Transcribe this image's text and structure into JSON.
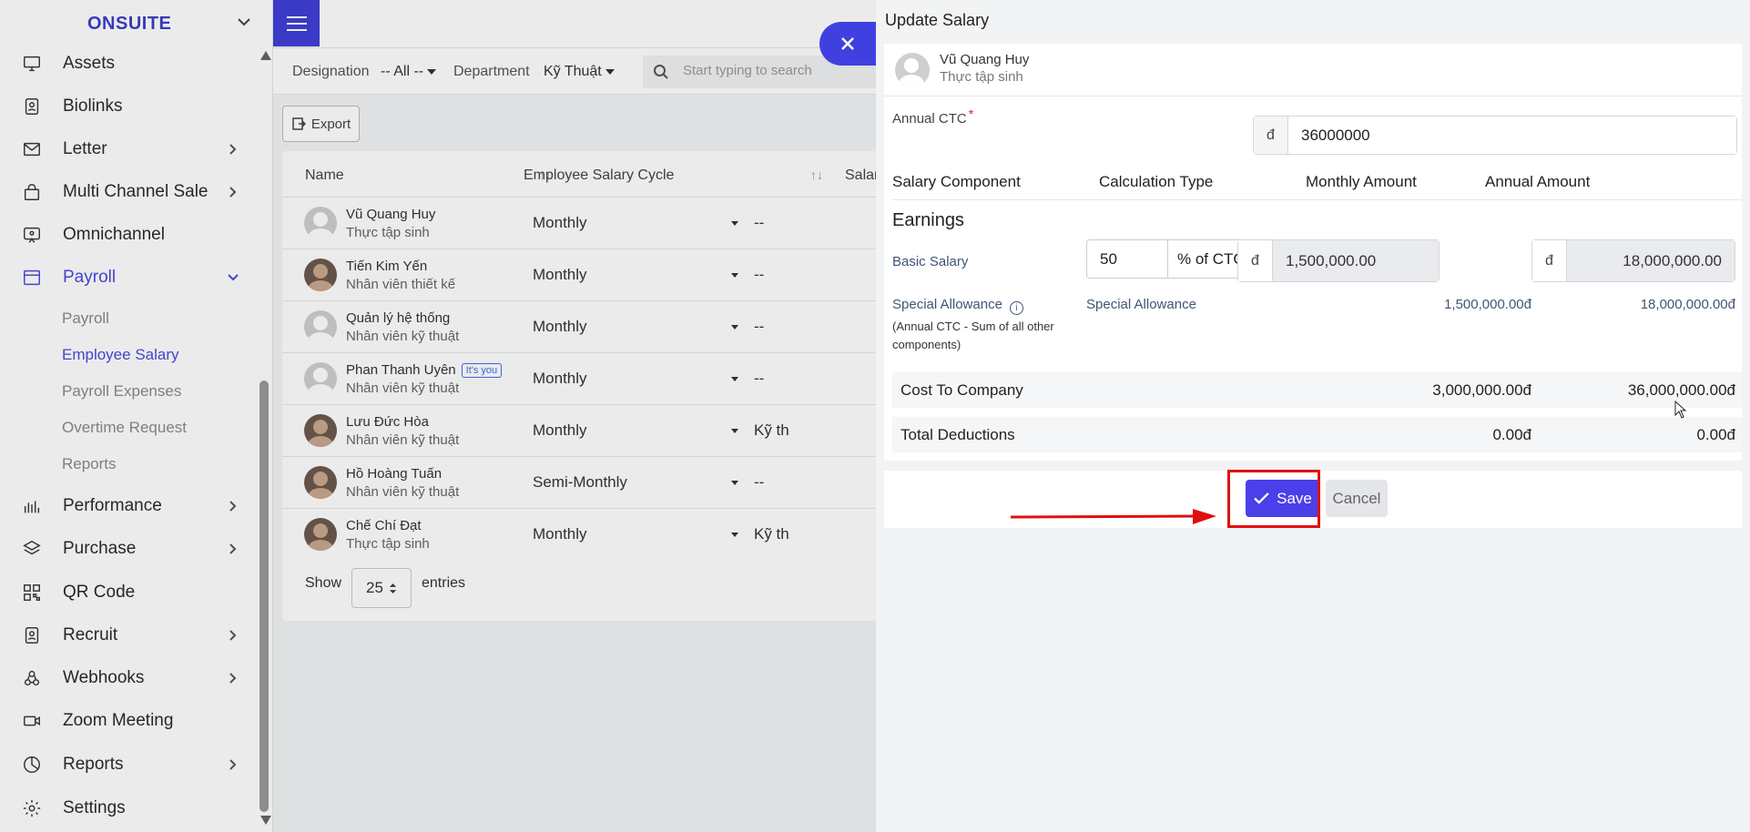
{
  "sidebar": {
    "brand": "ONSUITE",
    "items": [
      {
        "label": "Assets",
        "icon": "monitor-icon"
      },
      {
        "label": "Biolinks",
        "icon": "id-card-icon"
      },
      {
        "label": "Letter",
        "icon": "mail-icon"
      },
      {
        "label": "Multi Channel Sale",
        "icon": "bag-icon"
      },
      {
        "label": "Omnichannel",
        "icon": "chat-icon"
      },
      {
        "label": "Payroll",
        "icon": "window-icon"
      },
      {
        "label": "Performance",
        "icon": "bar-chart-icon"
      },
      {
        "label": "Purchase",
        "icon": "layers-icon"
      },
      {
        "label": "QR Code",
        "icon": "qr-code-icon"
      },
      {
        "label": "Recruit",
        "icon": "id-card-icon"
      },
      {
        "label": "Webhooks",
        "icon": "webhook-icon"
      },
      {
        "label": "Zoom Meeting",
        "icon": "video-icon"
      },
      {
        "label": "Reports",
        "icon": "pie-chart-icon"
      },
      {
        "label": "Settings",
        "icon": "gear-icon"
      }
    ],
    "payroll_sub": [
      "Payroll",
      "Employee Salary",
      "Payroll Expenses",
      "Overtime Request",
      "Reports"
    ]
  },
  "filters": {
    "designation_label": "Designation",
    "designation_value": "-- All --",
    "department_label": "Department",
    "department_value": "Kỹ Thuật",
    "search_placeholder": "Start typing to search"
  },
  "toolbar": {
    "export_label": "Export"
  },
  "table": {
    "headers": [
      "Name",
      "Employee Salary Cycle",
      "Salar"
    ],
    "rows": [
      {
        "name": "Vũ Quang Huy",
        "role": "Thực tập sinh",
        "cycle": "Monthly",
        "salary": "--"
      },
      {
        "name": "Tiến Kim Yến",
        "role": "Nhân viên thiết kế",
        "cycle": "Monthly",
        "salary": "--"
      },
      {
        "name": "Quản lý hệ thống",
        "role": "Nhân viên kỹ thuật",
        "cycle": "Monthly",
        "salary": "--"
      },
      {
        "name": "Phan Thanh Uyên",
        "role": "Nhân viên kỹ thuật",
        "cycle": "Monthly",
        "salary": "--",
        "badge": "It's you"
      },
      {
        "name": "Lưu Đức Hòa",
        "role": "Nhân viên kỹ thuật",
        "cycle": "Monthly",
        "salary": "Kỹ th"
      },
      {
        "name": "Hồ Hoàng Tuấn",
        "role": "Nhân viên kỹ thuật",
        "cycle": "Semi-Monthly",
        "salary": "--"
      },
      {
        "name": "Chế Chí Đạt",
        "role": "Thực tập sinh",
        "cycle": "Monthly",
        "salary": "Kỹ th"
      }
    ],
    "show_label": "Show",
    "page_size": "25",
    "entries_label": "entries"
  },
  "drawer": {
    "title": "Update Salary",
    "employee": {
      "name": "Vũ Quang Huy",
      "role": "Thực tập sinh"
    },
    "annual_ctc_label": "Annual CTC",
    "currency_symbol": "đ",
    "annual_ctc_value": "36000000",
    "columns": [
      "Salary Component",
      "Calculation Type",
      "Monthly Amount",
      "Annual Amount"
    ],
    "earnings_title": "Earnings",
    "basic_salary": {
      "label": "Basic Salary",
      "percent": "50",
      "calc_type": "% of CTC",
      "monthly": "1,500,000.00",
      "annual": "18,000,000.00"
    },
    "special_allowance": {
      "label": "Special Allowance",
      "note": "(Annual CTC - Sum of all other components)",
      "calc_type": "Special Allowance",
      "monthly": "1,500,000.00đ",
      "annual": "18,000,000.00đ"
    },
    "cost_to_company": {
      "label": "Cost To Company",
      "monthly": "3,000,000.00đ",
      "annual": "36,000,000.00đ"
    },
    "total_deductions": {
      "label": "Total Deductions",
      "monthly": "0.00đ",
      "annual": "0.00đ"
    },
    "save_label": "Save",
    "cancel_label": "Cancel"
  },
  "colors": {
    "accent": "#4a3fe8",
    "highlight": "#e01010",
    "sidebar_active": "#4a4ae0"
  }
}
